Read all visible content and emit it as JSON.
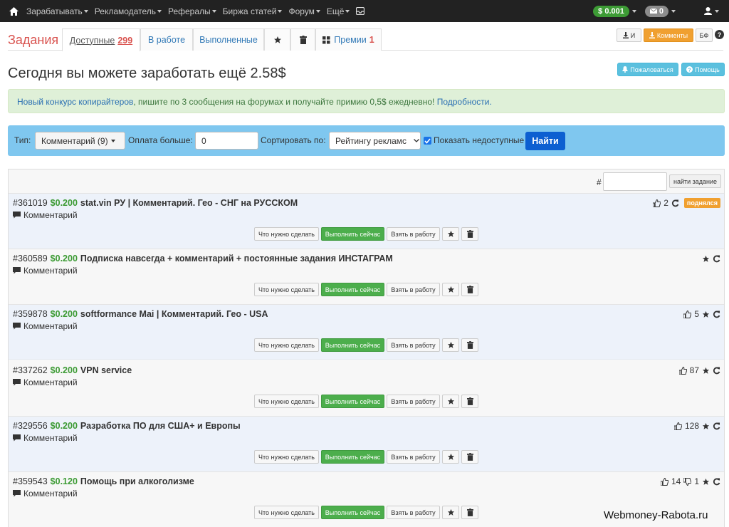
{
  "navbar": {
    "items": [
      "Зарабатывать",
      "Рекламодатель",
      "Рефералы",
      "Биржа статей",
      "Форум",
      "Ещё"
    ],
    "balance": "$ 0.001",
    "messages": "0"
  },
  "tabs": {
    "brand": "Задания",
    "items": [
      {
        "label": "Доступные",
        "count": "299"
      },
      {
        "label": "В работе"
      },
      {
        "label": "Выполненные"
      },
      {
        "label": "Премии",
        "count": "1"
      }
    ],
    "right_buttons": {
      "import": "И",
      "comments": "Комменты",
      "bf": "БФ"
    }
  },
  "page": {
    "title": "Сегодня вы можете заработать ещё 2.58$",
    "complain": "Пожаловаться",
    "help": "Помощь"
  },
  "alert": {
    "link1": "Новый конкурс копирайтеров",
    "text": ", пишите по 3 сообщения на форумах и получайте примию 0,5$ ежедневно!",
    "link2": "Подробности."
  },
  "filter": {
    "type_label": "Тип:",
    "type_value": "Комментарий (9)",
    "pay_label": "Оплата больше:",
    "pay_value": "0",
    "sort_label": "Сортировать по:",
    "sort_value": "Рейтингу рекламс",
    "show_unavailable": "Показать недоступные",
    "find": "Найти"
  },
  "search": {
    "hash": "#",
    "button": "найти задание"
  },
  "actions": {
    "what": "Что нужно сделать",
    "do_now": "Выполнить сейчас",
    "take": "Взять в работу"
  },
  "tasks": [
    {
      "id": "#361019",
      "price": "$0.200",
      "title": "stat.vin РУ | Комментарий. Гео - СНГ на РУССКОМ",
      "type": "Комментарий",
      "likes": "2",
      "badge": "поднялся"
    },
    {
      "id": "#360589",
      "price": "$0.200",
      "title": "Подписка навсегда + комментарий + постоянные задания ИНСТАГРАМ",
      "type": "Комментарий"
    },
    {
      "id": "#359878",
      "price": "$0.200",
      "title": "softformance Mai | Комментарий. Гео - USA",
      "type": "Комментарий",
      "likes": "5"
    },
    {
      "id": "#337262",
      "price": "$0.200",
      "title": "VPN service",
      "type": "Комментарий",
      "likes": "87"
    },
    {
      "id": "#329556",
      "price": "$0.200",
      "title": "Разработка ПО для США+ и Европы",
      "type": "Комментарий",
      "likes": "128"
    },
    {
      "id": "#359543",
      "price": "$0.120",
      "title": "Помощь при алкоголизме",
      "type": "Комментарий",
      "likes": "14",
      "dislikes": "1"
    }
  ],
  "watermark": "Webmoney-Rabota.ru"
}
